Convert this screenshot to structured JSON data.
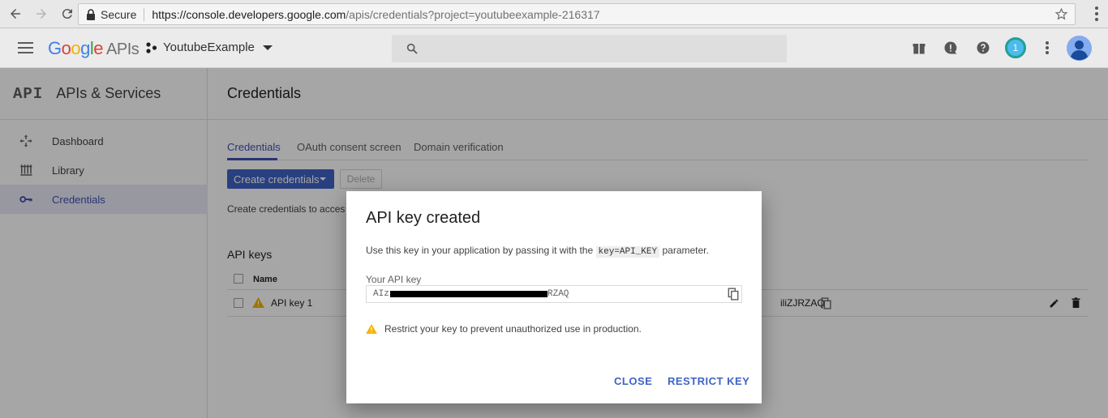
{
  "browser": {
    "secure_label": "Secure",
    "url_host": "https://console.developers.google.com",
    "url_path": "/apis/credentials?project=youtubeexample-216317"
  },
  "header": {
    "logo": {
      "google": "Google",
      "apis": "APIs"
    },
    "project_name": "YoutubeExample",
    "notification_count": "1"
  },
  "sidebar": {
    "mark": "API",
    "title": "APIs & Services",
    "items": [
      {
        "label": "Dashboard",
        "icon": "dashboard-icon"
      },
      {
        "label": "Library",
        "icon": "library-icon"
      },
      {
        "label": "Credentials",
        "icon": "key-icon",
        "active": true
      }
    ]
  },
  "main": {
    "title": "Credentials",
    "tabs": [
      {
        "label": "Credentials",
        "active": true
      },
      {
        "label": "OAuth consent screen"
      },
      {
        "label": "Domain verification"
      }
    ],
    "create_button": "Create credentials",
    "delete_button": "Delete",
    "hint": "Create credentials to acces",
    "section_title": "API keys",
    "table": {
      "columns": [
        "Name"
      ],
      "rows": [
        {
          "name": "API key 1",
          "key_tail": "iliZJRZAQ"
        }
      ]
    }
  },
  "dialog": {
    "title": "API key created",
    "desc_before": "Use this key in your application by passing it with the",
    "desc_code": "key=API_KEY",
    "desc_after": "parameter.",
    "field_label": "Your API key",
    "key_prefix": "AIz",
    "key_suffix": "RZAQ",
    "warning": "Restrict your key to prevent unauthorized use in production.",
    "close_button": "CLOSE",
    "restrict_button": "RESTRICT KEY"
  },
  "colors": {
    "accent": "#3f63c5",
    "active_bg": "#e8eaf6",
    "warning": "#f4b400"
  }
}
